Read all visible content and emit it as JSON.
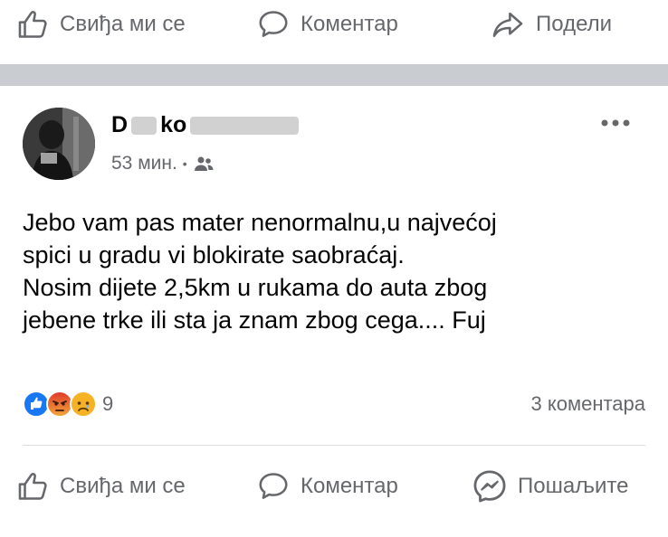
{
  "top_actions": {
    "like": "Свиђа ми се",
    "comment": "Коментар",
    "share": "Подели"
  },
  "post": {
    "author": "D  ko          ",
    "author_visible_fragments": [
      "D",
      "ko"
    ],
    "time": "53 мин.",
    "audience_icon": "friends-icon",
    "text": "Jebo vam pas mater nenormalnu,u najvećoj\nspici u gradu vi blokirate saobraćaj.\nNosim dijete 2,5km u rukama do auta zbog\njebene trke ili sta ja znam zbog cega.... Fuj",
    "reactions": {
      "icons": [
        "like",
        "angry",
        "sad"
      ],
      "count": "9"
    },
    "comments_count": "3 коментара"
  },
  "bottom_actions": {
    "like": "Свиђа ми се",
    "comment": "Коментар",
    "send": "Пошаљите"
  },
  "colors": {
    "text_secondary": "#65676b",
    "divider": "#c9ccd1",
    "like_blue": "#1877f2",
    "angry_red": "#e9710f",
    "sad_yellow": "#f7b125"
  }
}
